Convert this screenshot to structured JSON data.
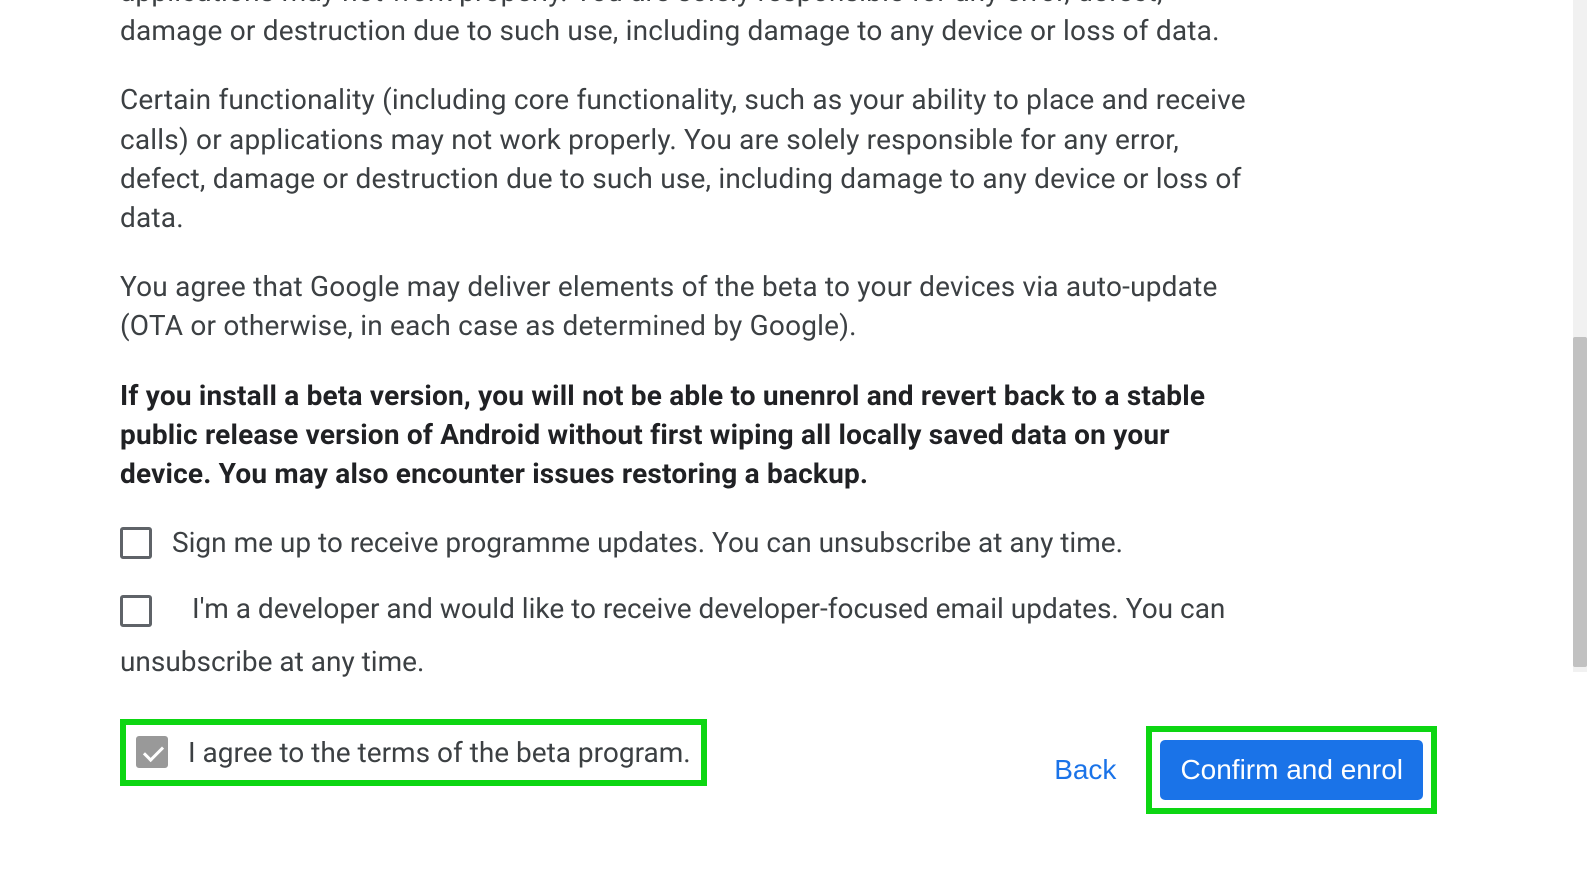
{
  "paragraphs": {
    "p1": "applications may not work properly. You are solely responsible for any error, defect, damage or destruction due to such use, including damage to any device or loss of data.",
    "p2": "Certain functionality (including core functionality, such as your ability to place and receive calls) or applications may not work properly. You are solely responsible for any error, defect, damage or destruction due to such use, including damage to any device or loss of data.",
    "p3": "You agree that Google may deliver elements of the beta to your devices via auto-update (OTA or otherwise, in each case as determined by Google).",
    "p4": "If you install a beta version, you will not be able to unenrol and revert back to a stable public release version of Android without first wiping all locally saved data on your device. You may also encounter issues restoring a backup."
  },
  "checkboxes": {
    "signup": "Sign me up to receive programme updates. You can unsubscribe at any time.",
    "developer": "I'm a developer and would like to receive developer-focused email updates. You can unsubscribe at any time.",
    "agree": "I agree to the terms of the beta program."
  },
  "buttons": {
    "back": "Back",
    "confirm": "Confirm and enrol"
  }
}
